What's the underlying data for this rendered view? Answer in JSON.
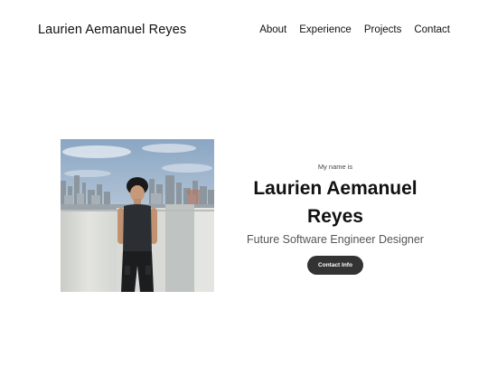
{
  "header": {
    "logo": "Laurien Aemanuel Reyes",
    "nav": [
      {
        "label": "About"
      },
      {
        "label": "Experience"
      },
      {
        "label": "Projects"
      },
      {
        "label": "Contact"
      }
    ]
  },
  "profile": {
    "eyebrow": "My name is",
    "name": "Laurien Aemanuel Reyes",
    "title": "Future Software Engineer Designer",
    "button_label": "Contact Info"
  },
  "colors": {
    "background": "#ffffff",
    "text": "#111111",
    "button_bg": "#333333",
    "button_text": "#ffffff"
  }
}
